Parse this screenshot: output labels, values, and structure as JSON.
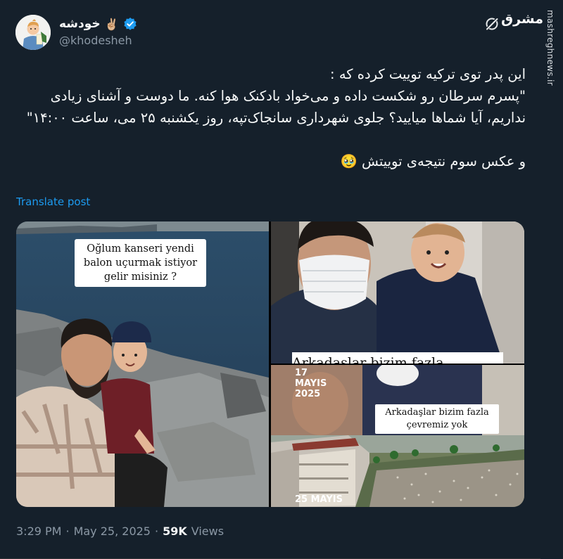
{
  "author": {
    "display_name": "خودشه",
    "emoji": "✌🏼",
    "handle": "@khodesheh"
  },
  "tweet": {
    "line1": "این پدر توی ترکیه توییت کرده که :",
    "line2": "\"پسرم سرطان رو شکست داده و می‌خواد بادکنک هوا کنه. ما دوست و آشنای زیادی نداریم، آیا شماها میایید؟ جلوی شهرداری سانجاک‌تپه، روز یکشنبه ۲۵ می، ساعت ۱۴:۰۰\"",
    "line3": "و عکس سوم نتیجه‌ی توییتش 🥹"
  },
  "translate_label": "Translate post",
  "media": {
    "left_caption": "Oğlum kanseri yendi balon uçurmak istiyor gelir misiniz ?",
    "top_right_cut_caption": "Arkadaşlar bizim fazla",
    "bottom_right_date1": "17 MAYIS 2025",
    "bottom_right_caption": "Arkadaşlar bizim fazla çevremiz yok",
    "bottom_right_date2": "25 MAYIS"
  },
  "meta": {
    "time": "3:29 PM",
    "sep1": "·",
    "date": "May 25, 2025",
    "sep2": "·",
    "views_count": "59K",
    "views_label": "Views"
  },
  "watermark": {
    "logo": "مشرق",
    "site": "mashreghnews.ir"
  },
  "colors": {
    "background": "#15202b",
    "text": "#f7f9f9",
    "secondary": "#8b98a5",
    "link": "#1d9bf0",
    "verified": "#1d9bf0"
  }
}
